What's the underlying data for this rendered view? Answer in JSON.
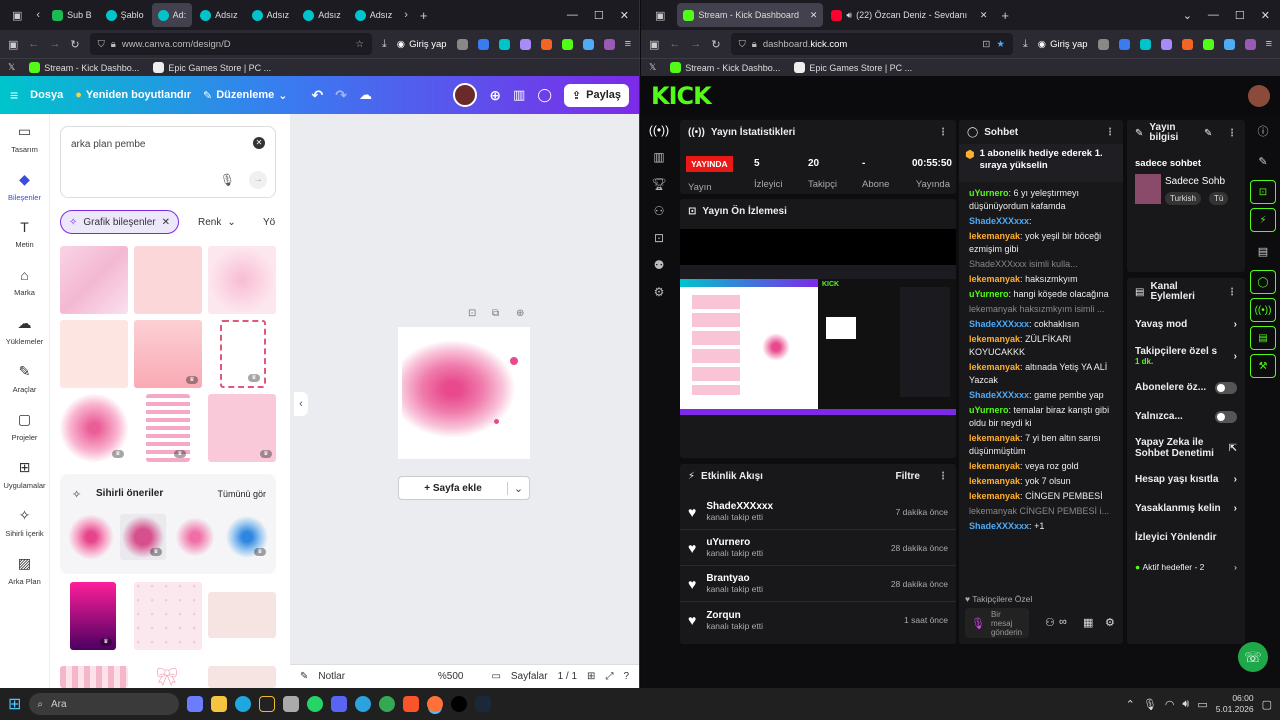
{
  "left_browser": {
    "tabs": [
      "Sub B",
      "Şablo",
      "Ad:",
      "Adsız",
      "Adsız",
      "Adsız",
      "Adsız"
    ],
    "url": "www.canva.com/design/D",
    "login_label": "Giriş yap",
    "bookmarks": [
      "Stream - Kick Dashbo...",
      "Epic Games Store | PC ..."
    ]
  },
  "right_browser": {
    "tabs": [
      "Stream - Kick Dashboard",
      "(22) Özcan Deniz - Sevdanı"
    ],
    "url_prefix": "dashboard.",
    "url_host": "kick.com",
    "login_label": "Giriş yap",
    "bookmarks": [
      "Stream - Kick Dashbo...",
      "Epic Games Store | PC ..."
    ]
  },
  "canva": {
    "menu": {
      "file": "Dosya",
      "resize": "Yeniden boyutlandır",
      "edit": "Düzenleme",
      "share": "Paylaş"
    },
    "sidebar": [
      "Tasarım",
      "Bileşenler",
      "Metin",
      "Marka",
      "Yüklemeler",
      "Araçlar",
      "Projeler",
      "Uygulamalar",
      "Sihirli İçerik",
      "Arka Plan"
    ],
    "search_value": "arka plan pembe",
    "filters": [
      "Grafik bileşenler",
      "Renk",
      "Yö"
    ],
    "magic": {
      "title": "Sihirli öneriler",
      "see_all": "Tümünü gör"
    },
    "add_page": "+ Sayfa ekle",
    "bottom": {
      "notes": "Notlar",
      "zoom": "%500",
      "pages": "Sayfalar",
      "page_count": "1 / 1"
    }
  },
  "kick": {
    "logo": "KICK",
    "stats": {
      "title": "Yayın İstatistikleri",
      "live_badge": "YAYINDA",
      "values": [
        "5",
        "20",
        "-",
        "00:55:50"
      ],
      "labels": [
        "Yayın",
        "İzleyici",
        "Takipçi",
        "Abone",
        "Yayında"
      ]
    },
    "preview_title": "Yayın Ön İzlemesi",
    "activity": {
      "title": "Etkinlik Akışı",
      "filter": "Filtre",
      "events": [
        {
          "user": "ShadeXXXxxx",
          "action": "kanalı takip etti",
          "time": "7 dakika önce"
        },
        {
          "user": "uYurnero",
          "action": "kanalı takip etti",
          "time": "28 dakika önce"
        },
        {
          "user": "Brantyao",
          "action": "kanalı takip etti",
          "time": "28 dakika önce"
        },
        {
          "user": "Zorqun",
          "action": "kanalı takip etti",
          "time": "1 saat önce"
        }
      ]
    },
    "chat": {
      "title": "Sohbet",
      "pinned": "1 abonelik hediye ederek 1. sıraya yükselin",
      "messages": [
        {
          "user": "uYurnero",
          "text": "6 yı yeleştırmeyı düşünüyordum kafamda",
          "cls": "u3"
        },
        {
          "user": "ShadeXXXxxx",
          "text": "",
          "cls": "u2"
        },
        {
          "user": "lekemanyak",
          "text": "yok yeşil bir böceği ezmişim gibi",
          "cls": "u1"
        },
        {
          "user": "ShadeXXXxxx",
          "text": "isimli kulla...",
          "cls": "sys"
        },
        {
          "user": "lekemanyak",
          "text": "haksızmkyım",
          "cls": "u1"
        },
        {
          "user": "uYurnero",
          "text": "hangi köşede olacağına",
          "cls": "u3"
        },
        {
          "user": "lekemanyak",
          "text": "haksızmkyım isimli ...",
          "cls": "sys"
        },
        {
          "user": "ShadeXXXxxx",
          "text": "cokhaklısın",
          "cls": "u2"
        },
        {
          "user": "lekemanyak",
          "text": "ZÜLFİKARI KOYUCAKKK",
          "cls": "u1"
        },
        {
          "user": "lekemanyak",
          "text": "altınada Yetiş YA ALİ Yazcak",
          "cls": "u1"
        },
        {
          "user": "ShadeXXXxxx",
          "text": "game pembe yap",
          "cls": "u2"
        },
        {
          "user": "uYurnero",
          "text": "temalar biraz karıştı gibi oldu bir neydi ki",
          "cls": "u3"
        },
        {
          "user": "lekemanyak",
          "text": "7 yi ben altın sarısı düşünmüştüm",
          "cls": "u1"
        },
        {
          "user": "lekemanyak",
          "text": "veya roz gold",
          "cls": "u1"
        },
        {
          "user": "lekemanyak",
          "text": "yok 7 olsun",
          "cls": "u1"
        },
        {
          "user": "lekemanyak",
          "text": "CİNGEN PEMBESİ",
          "cls": "u1"
        },
        {
          "user": "lekemanyak",
          "text": "CİNGEN PEMBESİ i...",
          "cls": "sys"
        },
        {
          "user": "ShadeXXXxxx",
          "text": "+1",
          "cls": "u2"
        }
      ],
      "followers_only": "Takipçilere Özel",
      "input_placeholder": "Bir mesaj gönderin"
    },
    "stream_info": {
      "title": "Yayın bilgisi",
      "category": "sadece sohbet",
      "stream_name": "Sadece Sohb",
      "tags": [
        "Turkish",
        "Tü"
      ]
    },
    "channel_actions": {
      "title": "Kanal Eylemleri",
      "items": [
        "Yavaş mod",
        "Takipçilere özel s",
        "Abonelere öz...",
        "Yalnızca...",
        "Yapay Zeka ile Sohbet Denetimi",
        "Hesap yaşı kısıtla",
        "Yasaklanmış kelin",
        "İzleyici Yönlendir",
        "Aktif hedefler - 2"
      ],
      "sub_label": "1 dk."
    }
  },
  "taskbar": {
    "search": "Ara",
    "time": "06:00",
    "date": "5.01.2026"
  },
  "colors": {
    "kick_green": "#53fc18",
    "canva_purple": "#7d2ae8",
    "live_red": "#e91916"
  }
}
